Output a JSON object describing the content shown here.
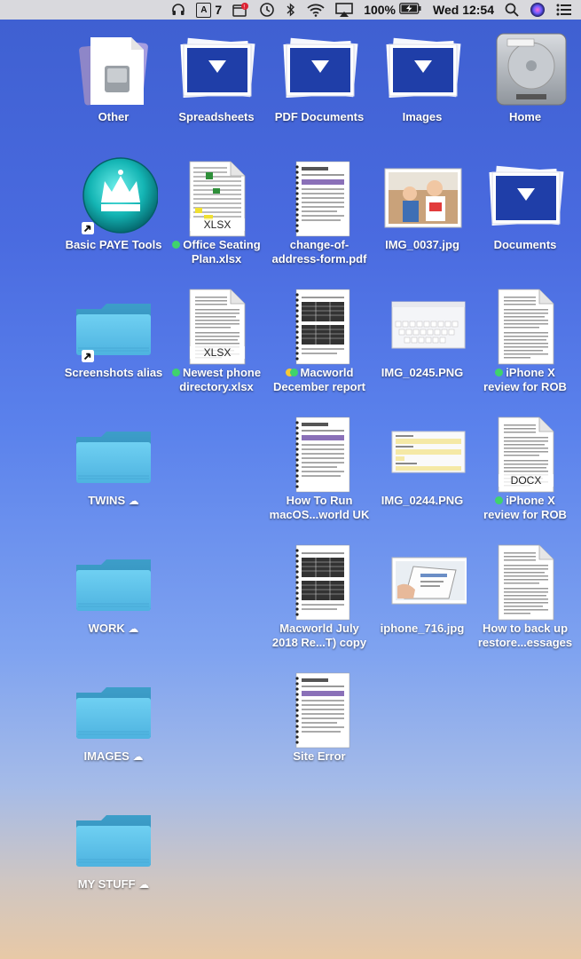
{
  "menubar": {
    "notification_count": "7",
    "battery_percent": "100%",
    "clock": "Wed 12:54"
  },
  "desktop": {
    "columns": [
      [
        {
          "name": "other",
          "label": "Other",
          "kind": "disk-doc"
        },
        {
          "name": "basic-paye-tools",
          "label": "Basic PAYE Tools",
          "kind": "app-crown",
          "alias": true
        },
        {
          "name": "screenshots-alias",
          "label": "Screenshots alias",
          "kind": "folder",
          "alias": true
        },
        {
          "name": "twins",
          "label": "TWINS",
          "kind": "folder",
          "cloud": true
        },
        {
          "name": "work",
          "label": "WORK",
          "kind": "folder",
          "cloud": true
        },
        {
          "name": "images-folder",
          "label": "IMAGES",
          "kind": "folder",
          "cloud": true
        },
        {
          "name": "my-stuff",
          "label": "MY STUFF",
          "kind": "folder",
          "cloud": true
        }
      ],
      [
        {
          "name": "spreadsheets",
          "label": "Spreadsheets",
          "kind": "stack"
        },
        {
          "name": "office-seating-plan",
          "label1": "Office Seating",
          "label2": "Plan.xlsx",
          "kind": "xlsx",
          "tag": "green"
        },
        {
          "name": "newest-phone-directory",
          "label1": "Newest phone",
          "label2": "directory.xlsx",
          "kind": "xlsx",
          "tag": "green"
        }
      ],
      [
        {
          "name": "pdf-documents",
          "label": "PDF Documents",
          "kind": "stack"
        },
        {
          "name": "change-of-address-form",
          "label1": "change-of-",
          "label2": "address-form.pdf",
          "kind": "pdf"
        },
        {
          "name": "macworld-december-report",
          "label1": "Macworld",
          "label2": "December report",
          "kind": "pdf-table",
          "tag": "multi"
        },
        {
          "name": "how-to-run-macos",
          "label1": "How To Run",
          "label2": "macOS...world UK",
          "kind": "pdf"
        },
        {
          "name": "macworld-july-2018",
          "label1": "Macworld July",
          "label2": "2018 Re...T) copy",
          "kind": "pdf-table"
        },
        {
          "name": "site-error",
          "label": "Site Error",
          "kind": "pdf"
        }
      ],
      [
        {
          "name": "images-stack",
          "label": "Images",
          "kind": "stack"
        },
        {
          "name": "img-0037",
          "label": "IMG_0037.jpg",
          "kind": "photo"
        },
        {
          "name": "img-0245",
          "label": "IMG_0245.PNG",
          "kind": "screenshot-keyboard"
        },
        {
          "name": "img-0244",
          "label": "IMG_0244.PNG",
          "kind": "screenshot-form"
        },
        {
          "name": "iphone-716",
          "label": "iphone_716.jpg",
          "kind": "photo-hand"
        }
      ],
      [
        {
          "name": "home",
          "label": "Home",
          "kind": "hdd"
        },
        {
          "name": "documents",
          "label": "Documents",
          "kind": "stack"
        },
        {
          "name": "iphone-x-review-1",
          "label1": "iPhone X",
          "label2": "review for ROB",
          "kind": "text-doc",
          "tag": "green"
        },
        {
          "name": "iphone-x-review-2",
          "label1": "iPhone X",
          "label2": "review for ROB",
          "kind": "docx",
          "tag": "green"
        },
        {
          "name": "how-to-back-up",
          "label1": "How to back up",
          "label2": "restore...essages",
          "kind": "text-doc"
        }
      ]
    ],
    "file_badges": {
      "xlsx": "XLSX",
      "docx": "DOCX"
    }
  },
  "colors": {
    "tag_green": "#3fd36c",
    "tag_yellow": "#f5c935",
    "folder": "#5ec3ea"
  }
}
